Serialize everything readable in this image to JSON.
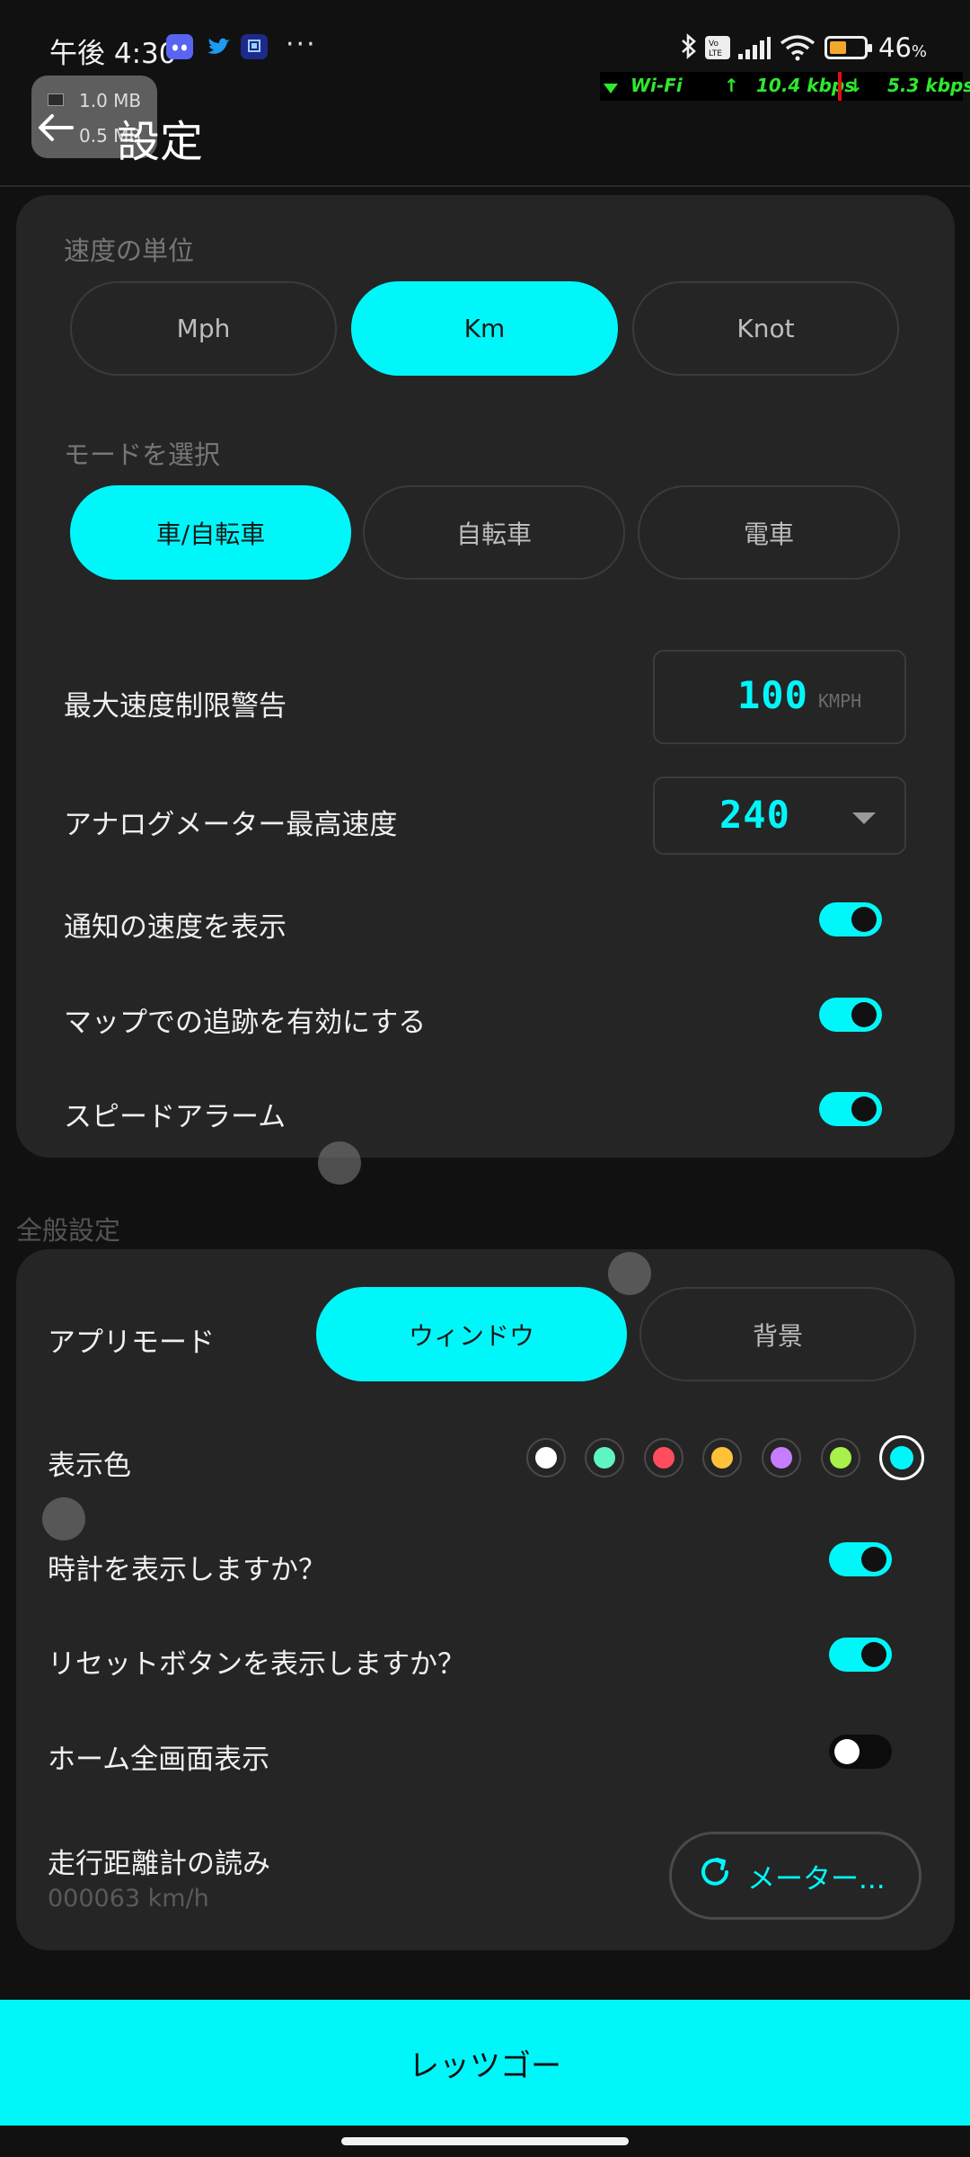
{
  "status_bar": {
    "time": "午後 4:30",
    "dots": "···",
    "battery_percent": "46",
    "battery_suffix": "%"
  },
  "net_overlay": {
    "wifi_label": "Wi-Fi",
    "upload": "10.4 kbps",
    "download": "5.3 kbps"
  },
  "data_overlay": {
    "row1": "1.0 MB",
    "row2": "0.5 MB"
  },
  "header": {
    "title": "設定"
  },
  "speed_settings": {
    "unit_label": "速度の単位",
    "units": [
      "Mph",
      "Km",
      "Knot"
    ],
    "mode_label": "モードを選択",
    "modes": [
      "車/自転車",
      "自転車",
      "電車"
    ],
    "max_speed_warning_label": "最大速度制限警告",
    "max_speed_value": "100",
    "max_speed_unit": "KMPH",
    "analog_max_label": "アナログメーター最高速度",
    "analog_max_value": "240",
    "toggle_rows": [
      {
        "label": "通知の速度を表示",
        "on": true
      },
      {
        "label": "マップでの追跡を有効にする",
        "on": true
      },
      {
        "label": "スピードアラーム",
        "on": true
      }
    ]
  },
  "general_settings": {
    "section_title": "全般設定",
    "app_mode_label": "アプリモード",
    "app_modes": [
      "ウィンドウ",
      "背景"
    ],
    "display_color_label": "表示色",
    "colors": [
      "#ffffff",
      "#5ff5c0",
      "#ff4d5e",
      "#ffc23a",
      "#c77dff",
      "#a8f04a",
      "#00f7fa"
    ],
    "toggle_rows": [
      {
        "label": "時計を表示しますか？",
        "on": true
      },
      {
        "label": "リセットボタンを表示しますか？",
        "on": true
      },
      {
        "label": "ホーム全画面表示",
        "on": false
      }
    ],
    "odometer_label": "走行距離計の読み",
    "odometer_value": "000063 km/h",
    "meter_button_label": "メーター..."
  },
  "footer": {
    "go_label": "レッツゴー"
  }
}
